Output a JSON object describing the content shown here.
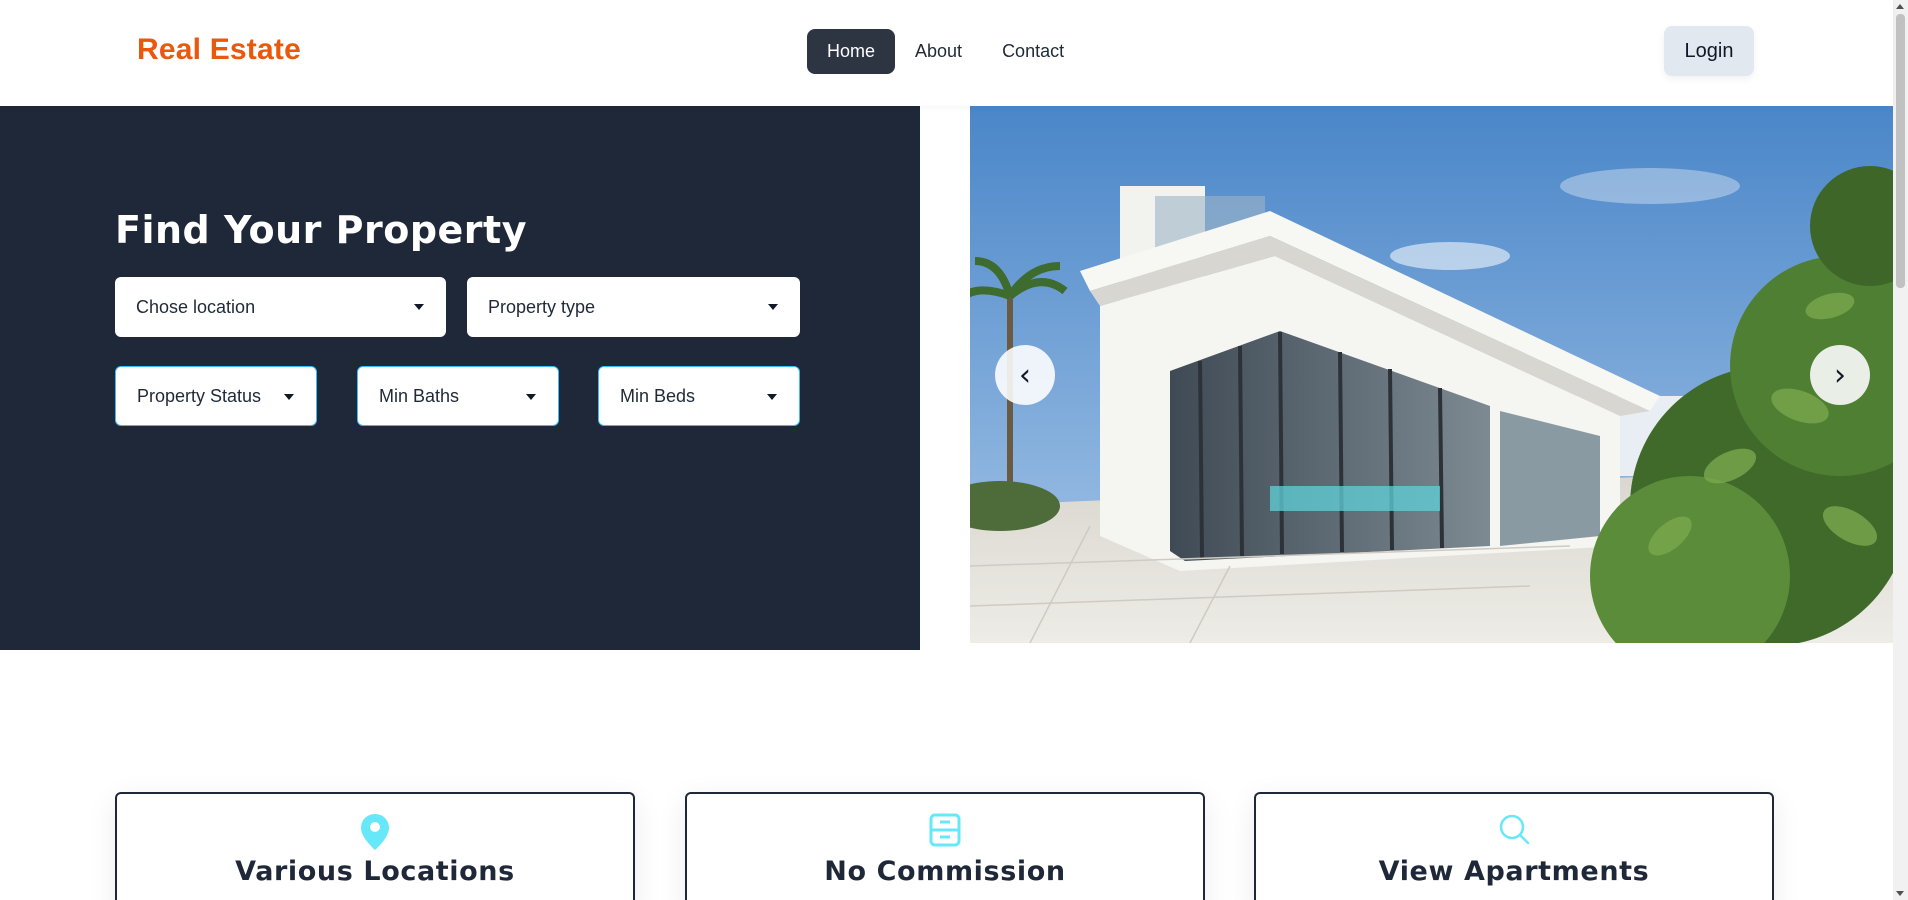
{
  "brand": {
    "name": "Real Estate",
    "color": "#ea580c"
  },
  "nav": {
    "items": [
      {
        "label": "Home",
        "active": true
      },
      {
        "label": "About",
        "active": false
      },
      {
        "label": "Contact",
        "active": false
      }
    ],
    "login_label": "Login"
  },
  "hero": {
    "title": "Find Your Property",
    "filters": {
      "location": "Chose location",
      "property_type": "Property type",
      "property_status": "Property Status",
      "min_baths": "Min Baths",
      "min_beds": "Min Beds"
    },
    "carousel": {
      "prev_icon": "‹",
      "next_icon": "›"
    },
    "background_color": "#1f2838"
  },
  "features": [
    {
      "icon": "map-pin-icon",
      "title": "Various Locations"
    },
    {
      "icon": "cabinet-icon",
      "title": "No Commission"
    },
    {
      "icon": "search-icon",
      "title": "View Apartments"
    }
  ],
  "colors": {
    "accent": "#67e8f9",
    "dark": "#1f2838",
    "button_light": "#e2e8f0"
  }
}
